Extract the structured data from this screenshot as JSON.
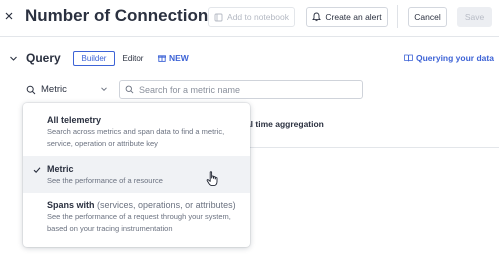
{
  "header": {
    "title": "Number of Connections",
    "add_to_notebook": "Add to notebook",
    "create_alert": "Create an alert",
    "cancel": "Cancel",
    "save": "Save"
  },
  "query": {
    "title": "Query",
    "tabs": [
      "Builder",
      "Editor"
    ],
    "active_tab": "Builder",
    "new_label": "NEW",
    "docs_link": "Querying your data"
  },
  "selector": {
    "value": "Metric",
    "search_placeholder": "Search for a metric name"
  },
  "background_text": "d final time aggregation",
  "dropdown": {
    "options": [
      {
        "title": "All telemetry",
        "title_suffix": "",
        "desc": "Search across metrics and span data to find a metric, service, operation or attribute key",
        "selected": false
      },
      {
        "title": "Metric",
        "title_suffix": "",
        "desc": "See the performance of a resource",
        "selected": true
      },
      {
        "title": "Spans with",
        "title_suffix": "(services, operations, or attributes)",
        "desc": "See the performance of a request through your system, based on your tracing instrumentation",
        "selected": false
      }
    ]
  },
  "colors": {
    "accent": "#3d63d6",
    "text": "#2b3140",
    "muted": "#6b7280",
    "hover": "#f0f2f5"
  }
}
